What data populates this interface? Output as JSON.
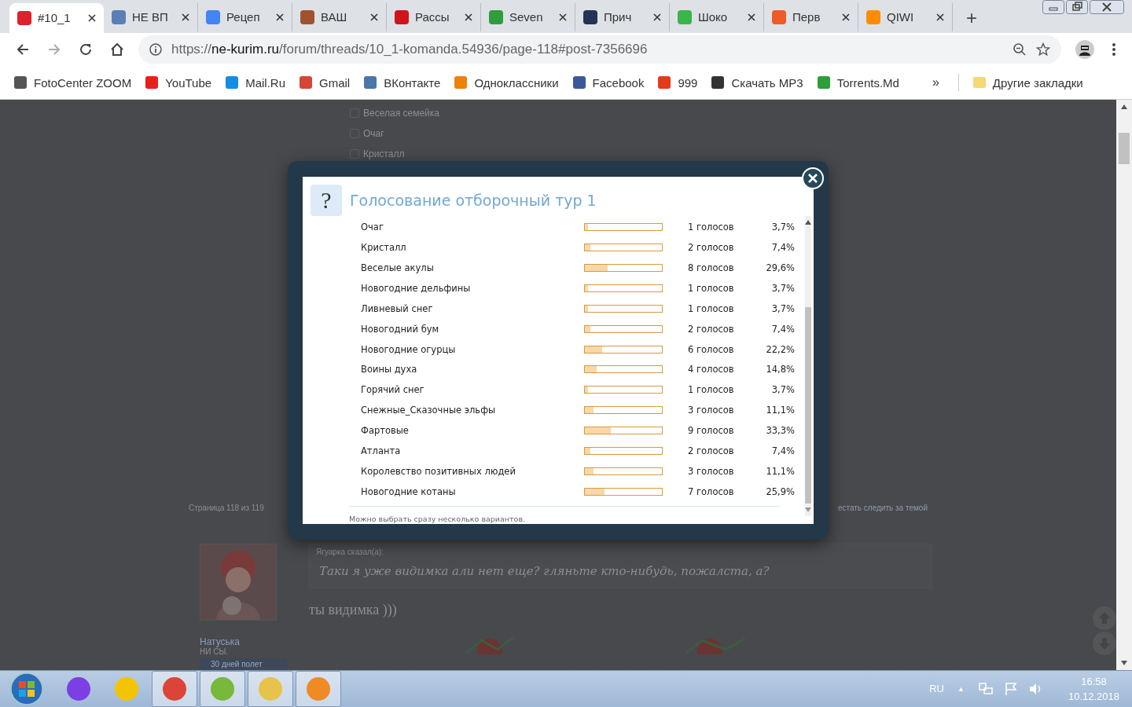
{
  "browser": {
    "tabs": [
      {
        "title": "#10_1",
        "selected": true
      },
      {
        "title": "НЕ ВП",
        "selected": false
      },
      {
        "title": "Рецеп",
        "selected": false
      },
      {
        "title": "ВАШ",
        "selected": false
      },
      {
        "title": "Рассы",
        "selected": false
      },
      {
        "title": "Seven",
        "selected": false
      },
      {
        "title": "Прич",
        "selected": false
      },
      {
        "title": "Шоко",
        "selected": false
      },
      {
        "title": "Перв",
        "selected": false
      },
      {
        "title": "QIWI",
        "selected": false
      }
    ],
    "new_tab": "+",
    "address": {
      "scheme": "https://",
      "host": "ne-kurim.ru",
      "path": "/forum/threads/10_1-komanda.54936/page-118#post-7356696"
    },
    "bookmarks": [
      "FotoCenter ZOOM",
      "YouTube",
      "Mail.Ru",
      "Gmail",
      "ВКонтакте",
      "Одноклассники",
      "Facebook",
      "999",
      "Скачать MP3",
      "Torrents.Md"
    ],
    "more_bookmarks": "»",
    "other_bookmarks": "Другие закладки"
  },
  "page": {
    "options_behind": [
      "Веселая семейка",
      "Очаг",
      "Кристалл"
    ],
    "pagination": "Страница 118 из 119",
    "watch_link": "естать следить за темой",
    "post": {
      "author": "Натуська",
      "status": "НИ СЫ.",
      "badge": "30 дней полет",
      "quote_author": "Ягуарка сказал(а):",
      "quote": "Таки я уже видимка али нет еще? гляньте кто-нибудь, пожалста, а?",
      "message": "ты видимка )))"
    }
  },
  "poll": {
    "title": "Голосование отборочный тур 1",
    "icon": "?",
    "rows": [
      {
        "label": "Очаг",
        "level": 0.037,
        "votes": "1 голосов",
        "percent": "3,7%"
      },
      {
        "label": "Кристалл",
        "level": 0.074,
        "votes": "2 голосов",
        "percent": "7,4%"
      },
      {
        "label": "Веселые акулы",
        "level": 0.296,
        "votes": "8 голосов",
        "percent": "29,6%"
      },
      {
        "label": "Новогодние дельфины",
        "level": 0.037,
        "votes": "1 голосов",
        "percent": "3,7%"
      },
      {
        "label": "Ливневый снег",
        "level": 0.037,
        "votes": "1 голосов",
        "percent": "3,7%"
      },
      {
        "label": "Новогодний бум",
        "level": 0.074,
        "votes": "2 голосов",
        "percent": "7,4%"
      },
      {
        "label": "Новогодние огурцы",
        "level": 0.222,
        "votes": "6 голосов",
        "percent": "22,2%"
      },
      {
        "label": "Воины духа",
        "level": 0.148,
        "votes": "4 голосов",
        "percent": "14,8%"
      },
      {
        "label": "Горячий снег",
        "level": 0.037,
        "votes": "1 голосов",
        "percent": "3,7%"
      },
      {
        "label": "Снежные_Сказочные эльфы",
        "level": 0.111,
        "votes": "3 голосов",
        "percent": "11,1%"
      },
      {
        "label": "Фартовые",
        "level": 0.333,
        "votes": "9 голосов",
        "percent": "33,3%"
      },
      {
        "label": "Атланта",
        "level": 0.074,
        "votes": "2 голосов",
        "percent": "7,4%"
      },
      {
        "label": "Королевство позитивных людей",
        "level": 0.111,
        "votes": "3 голосов",
        "percent": "11,1%"
      },
      {
        "label": "Новогодние котаны",
        "level": 0.259,
        "votes": "7 голосов",
        "percent": "25,9%"
      }
    ],
    "note": "Можно выбрать сразу несколько вариантов."
  },
  "taskbar": {
    "apps": [
      {
        "running": false
      },
      {
        "running": false
      },
      {
        "running": true
      },
      {
        "running": true
      },
      {
        "running": true
      },
      {
        "running": true
      }
    ],
    "language": "RU",
    "tray_toggle": "▲",
    "time": "16:58",
    "date": "10.12.2018"
  }
}
